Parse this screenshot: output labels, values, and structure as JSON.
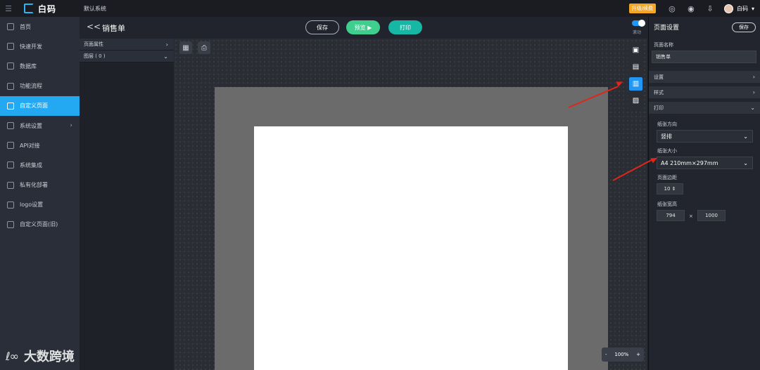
{
  "topbar": {
    "logo_text": "白码",
    "system_name": "默认系统",
    "upgrade_label": "升级/续费",
    "user_name": "白码"
  },
  "sidebar": {
    "items": [
      {
        "label": "首页"
      },
      {
        "label": "快速开发"
      },
      {
        "label": "数据库"
      },
      {
        "label": "功能流程"
      },
      {
        "label": "自定义页面"
      },
      {
        "label": "系统设置"
      },
      {
        "label": "API对接"
      },
      {
        "label": "系统集成"
      },
      {
        "label": "私有化部署"
      },
      {
        "label": "logo设置"
      },
      {
        "label": "自定义页面(旧)"
      }
    ]
  },
  "header": {
    "back_label": "<<",
    "title": "销售单",
    "save_label": "保存",
    "preview_label": "预览",
    "print_label": "打印",
    "toggle_label": "滚动"
  },
  "props_panel": {
    "rows": [
      {
        "label": "页面属性",
        "arrow": "›"
      },
      {
        "label": "图层 ( 0 )",
        "arrow": "⌄"
      }
    ]
  },
  "zoom": {
    "minus": "-",
    "value": "100%",
    "plus": "+"
  },
  "right_panel": {
    "title": "页面设置",
    "save_label": "保存",
    "page_name_label": "页面名称",
    "page_name_value": "销售单",
    "sections": {
      "settings": "设置",
      "style": "样式",
      "print": "打印"
    },
    "paper_direction_label": "纸张方向",
    "paper_direction_value": "竖排",
    "paper_size_label": "纸张大小",
    "paper_size_value": "A4 210mm×297mm",
    "margin_label": "页面边距",
    "margin_value": "10",
    "paper_wh_label": "纸张宽高",
    "paper_width": "794",
    "wh_sep": "×",
    "paper_height": "1000"
  },
  "watermark": {
    "logo": "ℓ∞",
    "text": "大数跨境"
  },
  "colors": {
    "accent": "#23a8f2",
    "preview": "#3ecf8e",
    "print": "#17b7a6",
    "upgrade": "#f5a623",
    "annotation_arrow": "#e0261b"
  }
}
